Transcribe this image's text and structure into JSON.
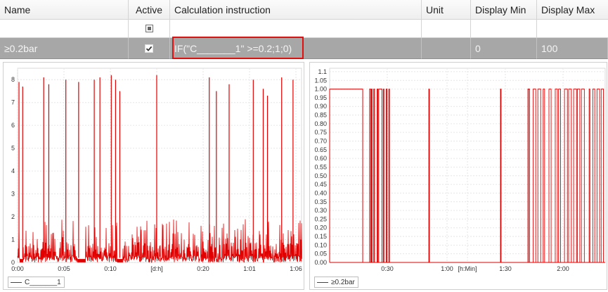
{
  "grid": {
    "headers": {
      "name": "Name",
      "active": "Active",
      "calc": "Calculation instruction",
      "unit": "Unit",
      "display_min": "Display Min",
      "display_max": "Display Max"
    },
    "row": {
      "name": "≥0.2bar",
      "active": true,
      "calc": "IF(\"C_______1\" >=0.2;1;0)",
      "unit": "",
      "display_min": "0",
      "display_max": "100"
    },
    "highlight_color": "#e01010",
    "row_color": "#a7a7a7"
  },
  "chart_data": [
    {
      "type": "line",
      "x_tick_labels": [
        "0:00",
        "0:05",
        "0:10",
        "[d:h]",
        "0:20",
        "1:01",
        "1:06"
      ],
      "y_tick_labels": [
        "0",
        "1",
        "2",
        "3",
        "4",
        "5",
        "6",
        "7",
        "8"
      ],
      "ylim": [
        0,
        8.5
      ],
      "grid": true,
      "legend": "bottom-left",
      "series": [
        {
          "name": "C_______1",
          "color": "#e00000",
          "shape": "noisy 0–2 with spikes to ~8",
          "spikes": [
            {
              "x_frac": 0.005,
              "y": 7.9
            },
            {
              "x_frac": 0.018,
              "y": 7.7
            },
            {
              "x_frac": 0.092,
              "y": 8.1
            },
            {
              "x_frac": 0.11,
              "y": 7.8
            },
            {
              "x_frac": 0.17,
              "y": 8.0
            },
            {
              "x_frac": 0.215,
              "y": 7.9
            },
            {
              "x_frac": 0.27,
              "y": 8.0
            },
            {
              "x_frac": 0.29,
              "y": 8.1
            },
            {
              "x_frac": 0.33,
              "y": 8.2
            },
            {
              "x_frac": 0.345,
              "y": 8.0
            },
            {
              "x_frac": 0.36,
              "y": 7.5
            },
            {
              "x_frac": 0.49,
              "y": 8.2
            },
            {
              "x_frac": 0.675,
              "y": 8.1
            },
            {
              "x_frac": 0.7,
              "y": 7.5
            },
            {
              "x_frac": 0.745,
              "y": 7.8
            },
            {
              "x_frac": 0.83,
              "y": 8.0
            },
            {
              "x_frac": 0.865,
              "y": 7.6
            },
            {
              "x_frac": 0.88,
              "y": 7.3
            },
            {
              "x_frac": 0.93,
              "y": 8.1
            },
            {
              "x_frac": 0.97,
              "y": 8.0
            }
          ]
        }
      ]
    },
    {
      "type": "line",
      "x_tick_labels": [
        "0:30",
        "1:00",
        "[h:Min]",
        "1:30",
        "2:00"
      ],
      "y_tick_labels": [
        "0.00",
        "0.05",
        "0.10",
        "0.15",
        "0.20",
        "0.25",
        "0.30",
        "0.35",
        "0.40",
        "0.45",
        "0.50",
        "0.55",
        "0.60",
        "0.65",
        "0.70",
        "0.75",
        "0.80",
        "0.85",
        "0.90",
        "0.95",
        "1.00",
        "1.05",
        "1.1"
      ],
      "ylim": [
        0,
        1.12
      ],
      "grid": true,
      "legend": "bottom-left",
      "series": [
        {
          "name": "≥0.2bar",
          "color": "#e00000",
          "shape": "binary 0/1 step signal",
          "one_segments": [
            [
              0.0,
              0.12
            ],
            [
              0.145,
              0.149
            ],
            [
              0.152,
              0.154
            ],
            [
              0.16,
              0.163
            ],
            [
              0.172,
              0.175
            ],
            [
              0.178,
              0.19
            ],
            [
              0.195,
              0.197
            ],
            [
              0.205,
              0.208
            ],
            [
              0.215,
              0.217
            ],
            [
              0.36,
              0.362
            ],
            [
              0.62,
              0.622
            ],
            [
              0.72,
              0.725
            ]
          ],
          "dense_start": 0.72
        }
      ]
    }
  ]
}
